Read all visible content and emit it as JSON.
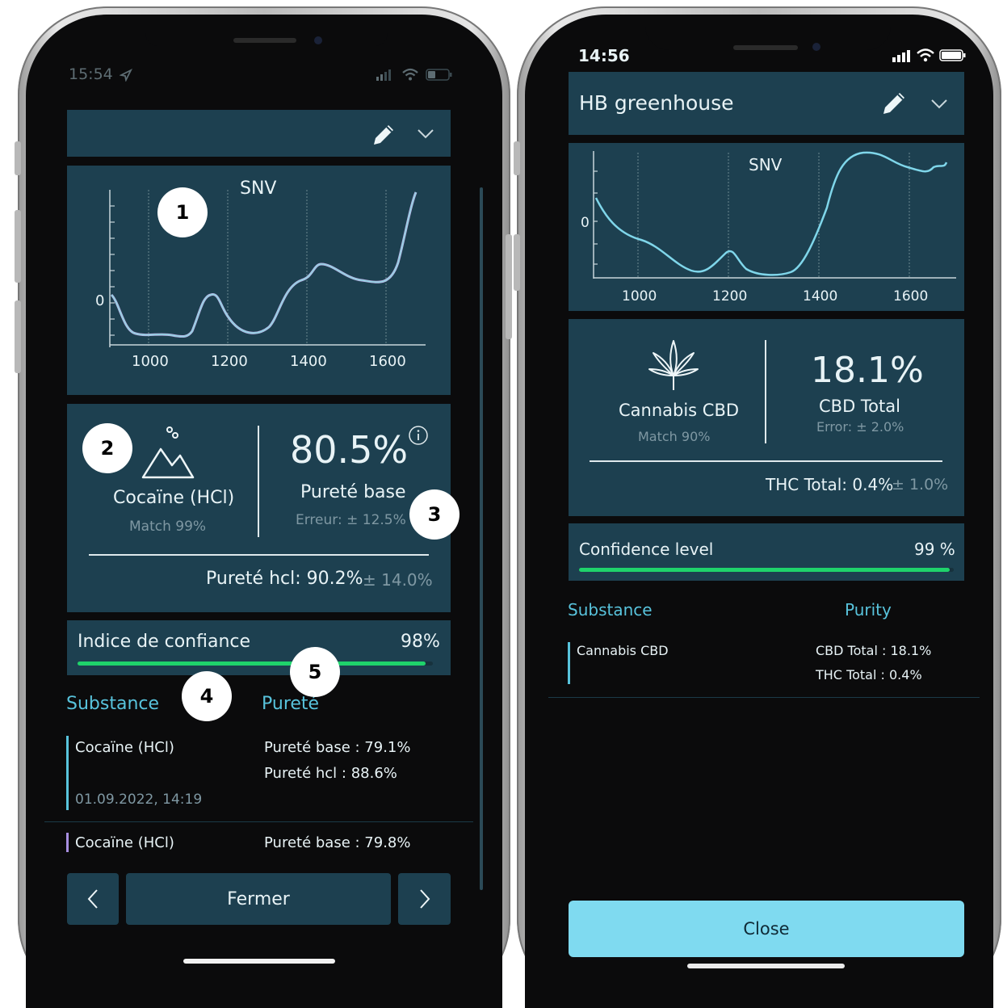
{
  "left_phone": {
    "status_time": "15:54",
    "chart_title": "SNV",
    "chart_axis": {
      "zero_label": "0",
      "x_ticks": [
        "1000",
        "1200",
        "1400",
        "1600"
      ]
    },
    "result": {
      "substance": "Cocaïne (HCl)",
      "match": "Match 99%",
      "purity_value": "80.5%",
      "purity_label": "Pureté base",
      "error": "Erreur: ± 12.5%",
      "secondary": "Pureté hcl: 90.2%",
      "secondary_error": "± 14.0%"
    },
    "confidence": {
      "label": "Indice de confiance",
      "value": "98%",
      "level": 0.98
    },
    "table": {
      "col_substance": "Substance",
      "col_purity": "Pureté",
      "rows": [
        {
          "substance": "Cocaïne (HCl)",
          "purity_1": "Pureté base : 79.1%",
          "purity_2": "Pureté hcl : 88.6%",
          "date": "01.09.2022, 14:19"
        },
        {
          "substance": "Cocaïne (HCl)",
          "purity_1": "Pureté base : 79.8%"
        }
      ]
    },
    "close_button": "Fermer",
    "callouts": [
      "1",
      "2",
      "3",
      "4",
      "5"
    ]
  },
  "right_phone": {
    "status_time": "14:56",
    "sample_name": "HB greenhouse",
    "chart_title": "SNV",
    "chart_axis": {
      "zero_label": "0",
      "x_ticks": [
        "1000",
        "1200",
        "1400",
        "1600"
      ]
    },
    "result": {
      "substance": "Cannabis CBD",
      "match": "Match 90%",
      "value": "18.1%",
      "value_label": "CBD Total",
      "error": "Error: ± 2.0%",
      "secondary": "THC Total: 0.4%",
      "secondary_error": "± 1.0%"
    },
    "confidence": {
      "label": "Confidence level",
      "value": "99 %",
      "level": 0.99
    },
    "table": {
      "col_substance": "Substance",
      "col_purity": "Purity",
      "rows": [
        {
          "substance": "Cannabis CBD",
          "purity_1": "CBD Total : 18.1%",
          "purity_2": "THC Total : 0.4%"
        }
      ]
    },
    "close_button": "Close"
  },
  "colors": {
    "screen_bg": "#0f2a36",
    "panel_bg": "#1d4050",
    "accent": "#58c3dc",
    "progress": "#1fd36b",
    "close_button_bg": "#7fdaf0"
  },
  "icons": [
    "navigation-arrow-icon",
    "signal-icon",
    "wifi-icon",
    "battery-icon",
    "pencil-icon",
    "chevron-down-icon",
    "mountain-icon",
    "info-icon",
    "cannabis-leaf-icon",
    "chevron-left-icon",
    "chevron-right-icon"
  ]
}
